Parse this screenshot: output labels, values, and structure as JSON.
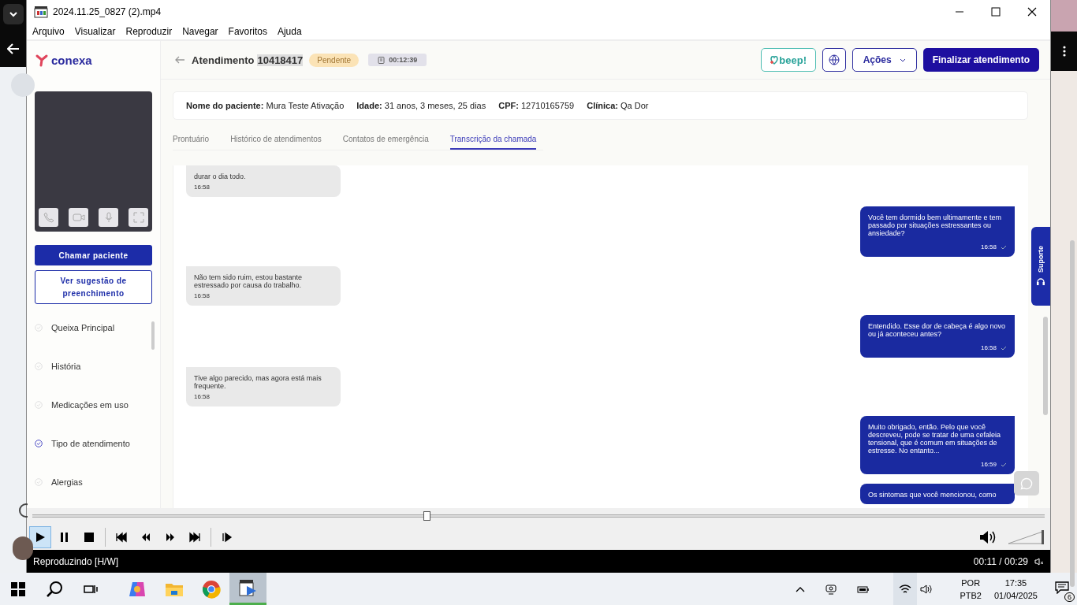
{
  "player": {
    "title": "2024.11.25_0827 (2).mp4",
    "menu": [
      "Arquivo",
      "Visualizar",
      "Reproduzir",
      "Navegar",
      "Favoritos",
      "Ajuda"
    ],
    "seek": {
      "level": 0.39
    },
    "controls": [
      {
        "kind": "play",
        "selected": true
      },
      {
        "kind": "pause",
        "selected": false
      },
      {
        "kind": "stop",
        "selected": false
      },
      {
        "kind": "prev",
        "selected": false
      },
      {
        "kind": "rewind",
        "selected": false
      },
      {
        "kind": "forward",
        "selected": false
      },
      {
        "kind": "next",
        "selected": false
      },
      {
        "kind": "step",
        "selected": false
      }
    ],
    "volume": {
      "level": 1
    },
    "status": "Reproduzindo [H/W]",
    "time": "00:11 / 00:29"
  },
  "app": {
    "logo": "conexa",
    "title": "Atendimento",
    "id": "10418417",
    "status": "Pendente",
    "timer": "00:12:39",
    "beep_logo": "beep!",
    "actions": "Ações",
    "finish": "Finalizar atendimento",
    "patient": [
      {
        "label": "Nome do paciente:",
        "value": "Mura Teste Ativação"
      },
      {
        "label": "Idade:",
        "value": "31 anos, 3 meses, 25 dias"
      },
      {
        "label": "CPF:",
        "value": "12710165759"
      },
      {
        "label": "Clínica:",
        "value": "Qa Dor"
      }
    ],
    "tabs": [
      {
        "label": "Prontuário",
        "selected": false
      },
      {
        "label": "Histórico de atendimentos",
        "selected": false
      },
      {
        "label": "Contatos de emergência",
        "selected": false
      },
      {
        "label": "Transcrição da chamada",
        "selected": true
      }
    ],
    "call_button": "Chamar paciente",
    "suggestion_button": "Ver sugestão de preenchimento",
    "sections": [
      {
        "label": "Queixa Principal",
        "checked": false
      },
      {
        "label": "História",
        "checked": false
      },
      {
        "label": "Medicações em uso",
        "checked": false
      },
      {
        "label": "Tipo de atendimento",
        "checked": true
      },
      {
        "label": "Alergias",
        "checked": false
      }
    ],
    "messages": [
      {
        "kind": "patient",
        "text": "durar o dia todo.",
        "time": "16:58"
      },
      {
        "kind": "doctor",
        "text": "Você tem dormido bem ultimamente e tem passado por situações estressantes ou ansiedade?",
        "time": "16:58"
      },
      {
        "kind": "patient",
        "text": "Não tem sido ruim, estou bastante estressado por causa do trabalho.",
        "time": "16:58"
      },
      {
        "kind": "doctor",
        "text": "Entendido. Esse dor de cabeça é algo novo ou já aconteceu antes?",
        "time": "16:58"
      },
      {
        "kind": "patient",
        "text": "Tive algo parecido, mas agora está mais frequente.",
        "time": "16:58"
      },
      {
        "kind": "doctor",
        "text": "Muito obrigado, então. Pelo que você descreveu, pode se tratar de uma cefaleia tensional, que é comum em situações de estresse. No entanto...",
        "time": "16:59"
      },
      {
        "kind": "doctor",
        "text": "Os sintomas que você mencionou, como"
      }
    ],
    "support": "Suporte"
  },
  "taskbar": {
    "apps": [
      {
        "kind": "copilot",
        "selected": false
      },
      {
        "kind": "folder",
        "selected": false
      },
      {
        "kind": "chrome",
        "selected": false
      },
      {
        "kind": "player",
        "selected": true
      }
    ],
    "language": "POR",
    "layout": "PTB2",
    "time": "17:35",
    "date": "01/04/2025",
    "notifications": "6"
  }
}
